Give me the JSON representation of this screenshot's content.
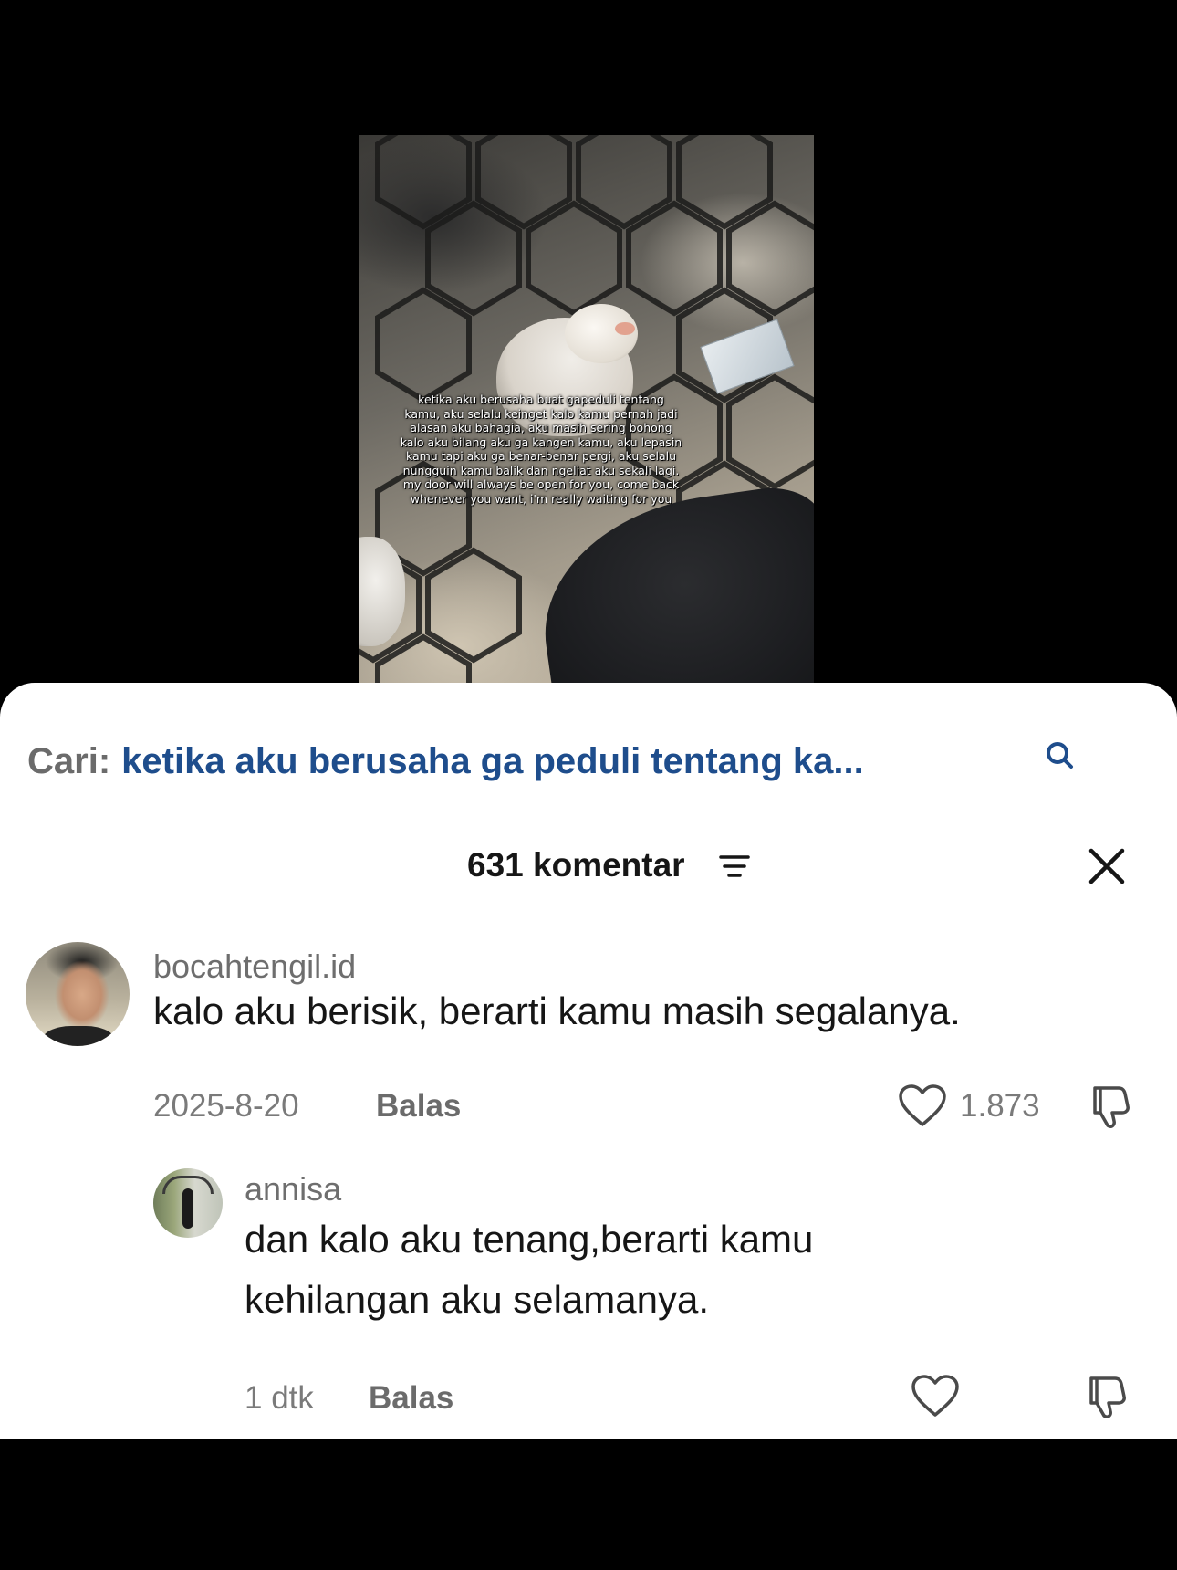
{
  "video": {
    "caption_lines": [
      "ketika aku berusaha buat gapeduli tentang",
      "kamu, aku selalu keinget kalo kamu pernah jadi",
      "alasan aku bahagia, aku masih sering bohong",
      "kalo aku bilang aku ga kangen kamu, aku lepasin",
      "kamu tapi aku ga benar-benar pergi, aku selalu",
      "nungguin kamu balik dan ngeliat aku sekali lagi.",
      "my door will always be open for you, come back",
      "whenever you want, i'm really waiting for you"
    ]
  },
  "search": {
    "prefix": "Cari:",
    "query": "ketika aku berusaha ga peduli tentang ka...",
    "icon": "search-icon"
  },
  "comments_header": {
    "count_label": "631 komentar",
    "filter_icon": "filter-icon",
    "close_icon": "close-icon"
  },
  "comments": [
    {
      "username": "bocahtengil.id",
      "text": "kalo aku berisik, berarti kamu masih segalanya.",
      "date": "2025-8-20",
      "reply_label": "Balas",
      "likes": "1.873"
    }
  ],
  "replies": [
    {
      "username": "annisa",
      "text_line1": "dan kalo aku tenang,berarti kamu",
      "text_line2": "kehilangan aku selamanya.",
      "date": "1 dtk",
      "reply_label": "Balas"
    }
  ],
  "colors": {
    "search_query": "#1e4d8c",
    "sheet_background": "#ffffff",
    "page_background": "#000000"
  }
}
